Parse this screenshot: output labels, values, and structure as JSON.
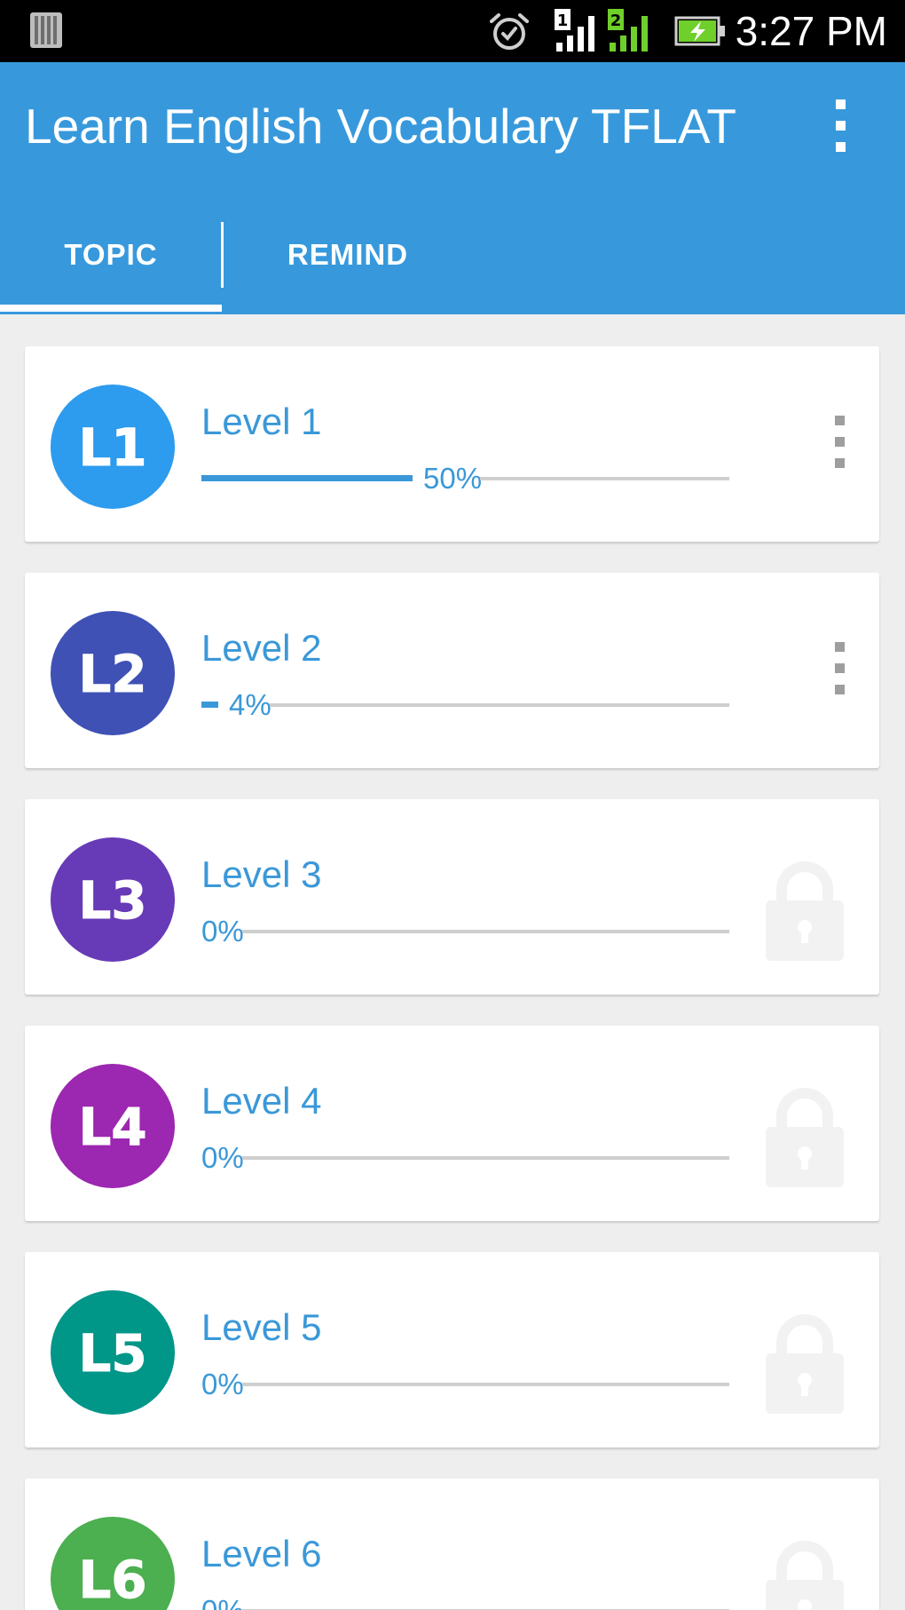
{
  "status_bar": {
    "time": "3:27 PM",
    "sim1_label": "1",
    "sim2_label": "2",
    "icons": [
      "notification-icon",
      "alarm-icon",
      "sim1-signal-icon",
      "sim2-signal-icon",
      "battery-charging-icon"
    ]
  },
  "app_bar": {
    "title": "Learn English Vocabulary TFLAT",
    "menu_icon": "overflow-menu-icon"
  },
  "tabs": [
    {
      "label": "TOPIC",
      "selected": true
    },
    {
      "label": "REMIND",
      "selected": false
    }
  ],
  "colors": {
    "primary": "#3799dc",
    "accent_text": "#3a98d8",
    "background": "#eeeeee",
    "track": "#cfcfcf",
    "lock": "#f2f2f2"
  },
  "levels": [
    {
      "name": "Level 1",
      "badge": "L1",
      "badge_color": "#2d9bee",
      "progress": 0.5,
      "progress_label": "50%",
      "locked": false
    },
    {
      "name": "Level 2",
      "badge": "L2",
      "badge_color": "#3f51b5",
      "progress": 0.04,
      "progress_label": "4%",
      "locked": false
    },
    {
      "name": "Level 3",
      "badge": "L3",
      "badge_color": "#673ab7",
      "progress": 0,
      "progress_label": "0%",
      "locked": true
    },
    {
      "name": "Level 4",
      "badge": "L4",
      "badge_color": "#9c27b0",
      "progress": 0,
      "progress_label": "0%",
      "locked": true
    },
    {
      "name": "Level 5",
      "badge": "L5",
      "badge_color": "#009688",
      "progress": 0,
      "progress_label": "0%",
      "locked": true
    },
    {
      "name": "Level 6",
      "badge": "L6",
      "badge_color": "#4caf50",
      "progress": 0,
      "progress_label": "0%",
      "locked": true
    }
  ]
}
